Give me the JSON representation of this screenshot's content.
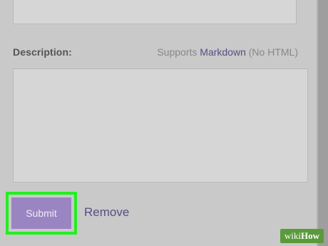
{
  "form": {
    "description_label": "Description:",
    "supports_prefix": "Supports ",
    "markdown_link": "Markdown",
    "supports_suffix": " (No HTML)",
    "description_value": ""
  },
  "actions": {
    "submit_label": "Submit",
    "remove_label": "Remove"
  },
  "colors": {
    "panel_background": "#c9c9c9",
    "field_background": "#d6d6d6",
    "submit_button": "#9a85c2",
    "link": "#594c86",
    "highlight": "#22ee22"
  },
  "watermark": {
    "wiki": "wiki",
    "how": "How"
  }
}
